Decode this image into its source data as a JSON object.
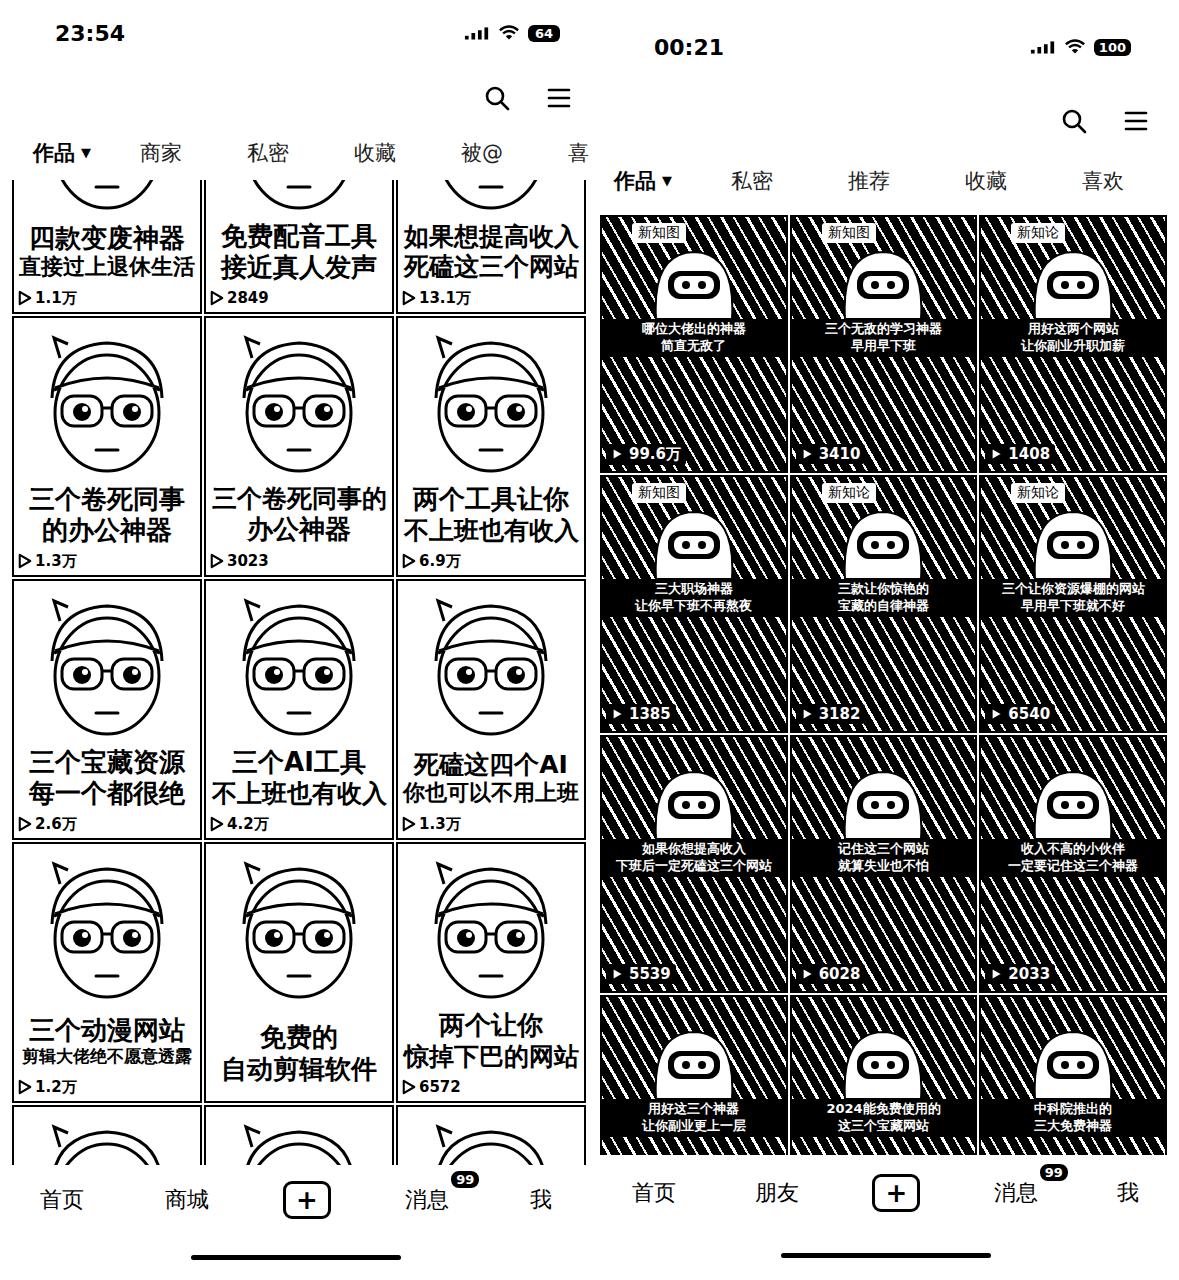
{
  "screens": [
    {
      "status_bar": {
        "time": "23:54",
        "battery": "64"
      },
      "tabs": [
        {
          "label": "作品",
          "arrow": "▼",
          "selected": true
        },
        {
          "label": "商家",
          "selected": false
        },
        {
          "label": "私密",
          "selected": false
        },
        {
          "label": "收藏",
          "selected": false
        },
        {
          "label": "被@",
          "selected": false
        },
        {
          "label": "喜",
          "selected": false
        }
      ],
      "videos": [
        {
          "kind": "face",
          "title_lines": [
            "四款变废神器",
            "直接过上退休生活"
          ],
          "views": "1.1万"
        },
        {
          "kind": "face",
          "title_lines": [
            "免费配音工具",
            "接近真人发声"
          ],
          "views": "2849"
        },
        {
          "kind": "face",
          "title_lines": [
            "如果想提高收入",
            "死磕这三个网站"
          ],
          "views": "13.1万"
        },
        {
          "kind": "face",
          "title_lines": [
            "三个卷死同事",
            "的办公神器"
          ],
          "views": "1.3万"
        },
        {
          "kind": "face",
          "title_lines": [
            "三个卷死同事的",
            "办公神器"
          ],
          "views": "3023"
        },
        {
          "kind": "face",
          "title_lines": [
            "两个工具让你",
            "不上班也有收入"
          ],
          "views": "6.9万"
        },
        {
          "kind": "face",
          "title_lines": [
            "三个宝藏资源",
            "每一个都很绝"
          ],
          "views": "2.6万"
        },
        {
          "kind": "face",
          "title_lines": [
            "三个AI工具",
            "不上班也有收入"
          ],
          "views": "4.2万"
        },
        {
          "kind": "face",
          "title_lines": [
            "死磕这四个AI",
            "你也可以不用上班"
          ],
          "views": "1.3万"
        },
        {
          "kind": "face",
          "title_lines": [
            "三个动漫网站",
            "剪辑大佬绝不愿意透露"
          ],
          "views": "1.2万"
        },
        {
          "kind": "face",
          "title_lines": [
            "免费的",
            "自动剪辑软件"
          ]
        },
        {
          "kind": "face",
          "title_lines": [
            "两个让你",
            "惊掉下巴的网站"
          ],
          "views": "6572"
        },
        {
          "kind": "face",
          "title_lines": []
        },
        {
          "kind": "face",
          "title_lines": []
        },
        {
          "kind": "face",
          "title_lines": []
        }
      ],
      "nav": [
        {
          "label": "首页",
          "kind": "text"
        },
        {
          "label": "商城",
          "kind": "text"
        },
        {
          "label": "+",
          "kind": "add"
        },
        {
          "label": "消息",
          "kind": "text",
          "badge": "99"
        },
        {
          "label": "我",
          "kind": "text"
        }
      ]
    },
    {
      "status_bar": {
        "time": "00:21",
        "battery": "100"
      },
      "tabs": [
        {
          "label": "作品",
          "arrow": "▼",
          "selected": true
        },
        {
          "label": "私密",
          "selected": false
        },
        {
          "label": "推荐",
          "selected": false
        },
        {
          "label": "收藏",
          "selected": false
        },
        {
          "label": "喜欢",
          "selected": false
        }
      ],
      "videos": [
        {
          "kind": "goggles",
          "tag": "新知图",
          "title_lines": [
            "哪位大佬出的神器",
            "简直无敌了"
          ],
          "views": "99.6万"
        },
        {
          "kind": "goggles",
          "tag": "新知图",
          "title_lines": [
            "三个无敌的学习神器",
            "早用早下班"
          ],
          "views": "3410"
        },
        {
          "kind": "goggles",
          "tag": "新知论",
          "title_lines": [
            "用好这两个网站",
            "让你副业升职加薪"
          ],
          "views": "1408"
        },
        {
          "kind": "goggles",
          "tag": "新知图",
          "title_lines": [
            "三大职场神器",
            "让你早下班不再熬夜"
          ],
          "views": "1385"
        },
        {
          "kind": "goggles",
          "tag": "新知论",
          "title_lines": [
            "三款让你惊艳的",
            "宝藏的自律神器"
          ],
          "views": "3182"
        },
        {
          "kind": "goggles",
          "tag": "新知论",
          "title_lines": [
            "三个让你资源爆棚的网站",
            "早用早下班就不好"
          ],
          "views": "6540"
        },
        {
          "kind": "goggles",
          "title_lines": [
            "如果你想提高收入",
            "下班后一定死磕这三个网站"
          ],
          "views": "5539"
        },
        {
          "kind": "goggles",
          "title_lines": [
            "记住这三个网站",
            "就算失业也不怕"
          ],
          "views": "6028"
        },
        {
          "kind": "goggles",
          "title_lines": [
            "收入不高的小伙伴",
            "一定要记住这三个神器"
          ],
          "views": "2033"
        },
        {
          "kind": "goggles",
          "title_lines": [
            "用好这三个神器",
            "让你副业更上一层"
          ]
        },
        {
          "kind": "goggles",
          "title_lines": [
            "2024能免费使用的",
            "这三个宝藏网站"
          ]
        },
        {
          "kind": "goggles",
          "title_lines": [
            "中科院推出的",
            "三大免费神器"
          ]
        }
      ],
      "nav": [
        {
          "label": "首页",
          "kind": "text"
        },
        {
          "label": "朋友",
          "kind": "text"
        },
        {
          "label": "+",
          "kind": "add"
        },
        {
          "label": "消息",
          "kind": "text",
          "badge": "99"
        },
        {
          "label": "我",
          "kind": "text"
        }
      ]
    }
  ]
}
